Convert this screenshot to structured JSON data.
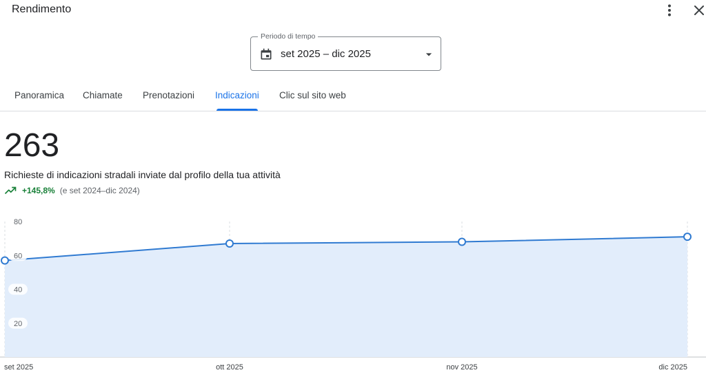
{
  "header": {
    "title": "Rendimento"
  },
  "period": {
    "label": "Periodo di tempo",
    "value": "set 2025 – dic 2025"
  },
  "tabs": [
    {
      "label": "Panoramica",
      "active": false
    },
    {
      "label": "Chiamate",
      "active": false
    },
    {
      "label": "Prenotazioni",
      "active": false
    },
    {
      "label": "Indicazioni",
      "active": true
    },
    {
      "label": "Clic sul sito web",
      "active": false
    }
  ],
  "metric": {
    "value": "263",
    "description": "Richieste di indicazioni stradali inviate dal profilo della tua attività",
    "trend_value": "+145,8%",
    "trend_compare": "(e set 2024–dic 2024)"
  },
  "colors": {
    "accent": "#1a73e8",
    "line": "#2f7ad1",
    "area": "#e2edfb",
    "positive": "#188038"
  },
  "icons": {
    "more": "more-vert-icon",
    "close": "close-icon",
    "calendar": "calendar-icon",
    "dropdown": "arrow-drop-down-icon",
    "trend": "trending-up-icon"
  },
  "chart_data": {
    "type": "area",
    "x": [
      "set 2025",
      "ott 2025",
      "nov 2025",
      "dic 2025"
    ],
    "values": [
      57,
      67,
      68,
      71
    ],
    "yticks": [
      "20",
      "40",
      "60",
      "80"
    ],
    "ylim": [
      0,
      80
    ],
    "grid": "vertical-dashed",
    "title": "",
    "xlabel": "",
    "ylabel": ""
  }
}
